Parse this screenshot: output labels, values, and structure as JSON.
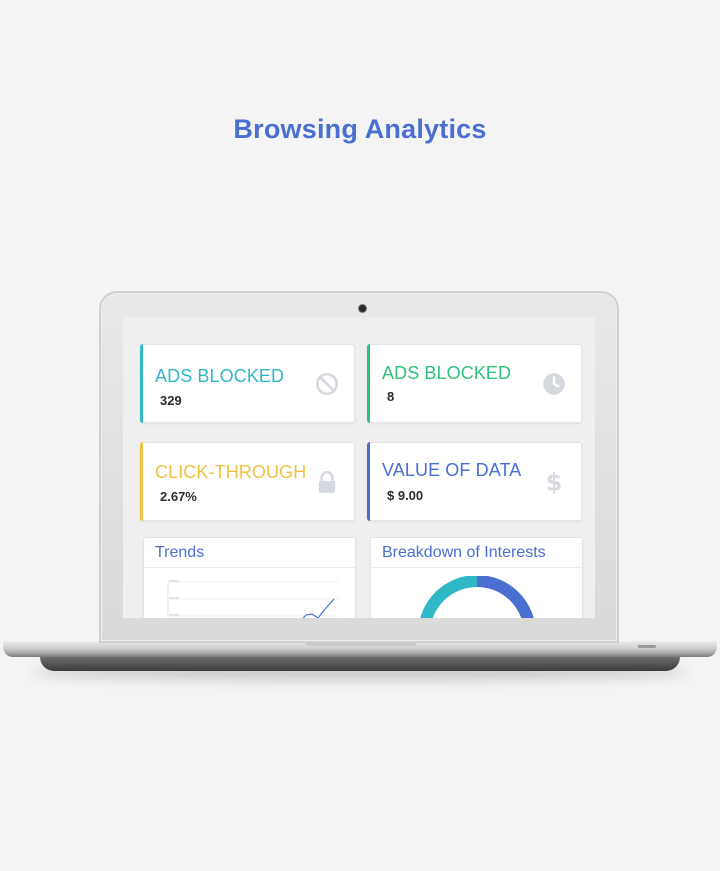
{
  "page": {
    "title": "Browsing Analytics"
  },
  "dashboard": {
    "cards": [
      {
        "label": "ADS BLOCKED",
        "value": "329",
        "icon": "prohibited-icon",
        "accent_color": "#30b8c6",
        "label_color": "#30b8c6"
      },
      {
        "label": "ADS BLOCKED",
        "value": "8",
        "icon": "clock-icon",
        "accent_color": "#2ec07c",
        "label_color": "#2ec07c"
      },
      {
        "label": "CLICK-THROUGH",
        "value": "2.67%",
        "icon": "lock-icon",
        "accent_color": "#f0c244",
        "label_color": "#f0c244"
      },
      {
        "label": "VALUE OF DATA",
        "value": "$ 9.00",
        "icon": "dollar-icon",
        "accent_color": "#4a6fd1",
        "label_color": "#4a6fd1"
      }
    ],
    "panels": [
      {
        "title": "Trends",
        "title_color": "#4a6fd1"
      },
      {
        "title": "Breakdown of Interests",
        "title_color": "#4a6fd1"
      }
    ]
  },
  "colors": {
    "title": "#4a6fd1",
    "icon_gray": "#d5d9df",
    "donut_teal": "#30b8c6",
    "donut_blue": "#4a6fd1"
  }
}
